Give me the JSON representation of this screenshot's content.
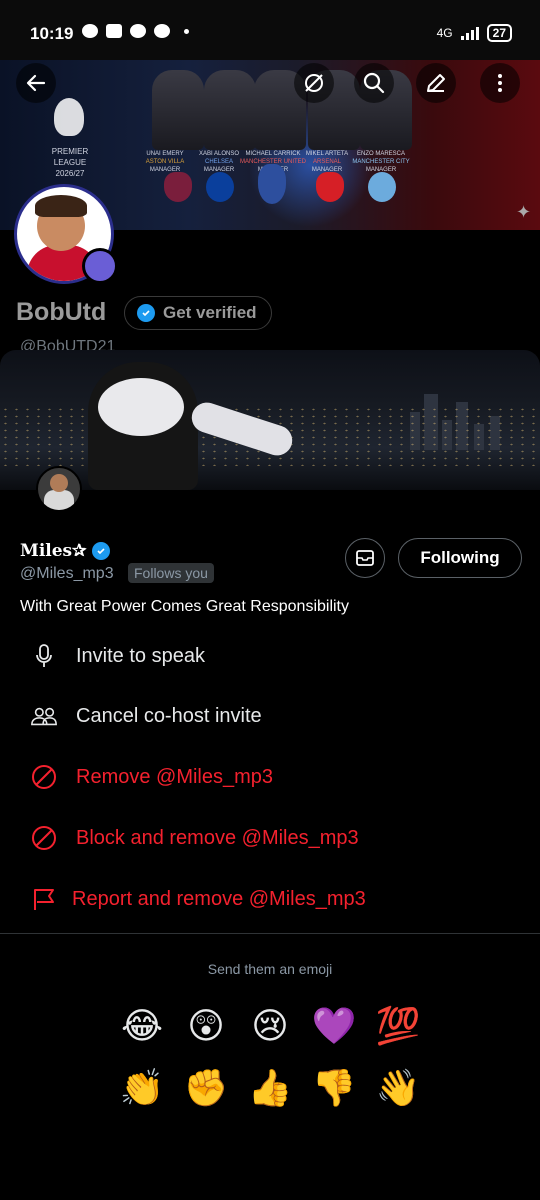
{
  "status_bar": {
    "time": "10:19",
    "network": "4G",
    "battery": "27"
  },
  "profile_header": {
    "banner": {
      "league": "PREMIER LEAGUE",
      "season": "2026/27",
      "managers": [
        {
          "name": "UNAI EMERY",
          "club": "ASTON VILLA",
          "role": "MANAGER"
        },
        {
          "name": "XABI ALONSO",
          "club": "CHELSEA",
          "role": "MANAGER"
        },
        {
          "name": "MICHAEL CARRICK",
          "club": "MANCHESTER UNITED",
          "role": "MANAGER"
        },
        {
          "name": "MIKEL ARTETA",
          "club": "ARSENAL",
          "role": "MANAGER"
        },
        {
          "name": "ENZO MARESCA",
          "club": "MANCHESTER CITY",
          "role": "MANAGER"
        }
      ]
    },
    "name": "BobUtd",
    "verify_label": "Get verified",
    "handle": "@BobUTD21"
  },
  "user_card": {
    "display_name": "Miles✰",
    "handle": "@Miles_mp3",
    "follows_you": "Follows you",
    "following_label": "Following",
    "bio": "With Great Power Comes Great Responsibility"
  },
  "actions": [
    {
      "label": "Invite to speak",
      "icon": "microphone-icon",
      "color": "#e7e9ea"
    },
    {
      "label": "Cancel co-host invite",
      "icon": "people-icon",
      "color": "#e7e9ea"
    },
    {
      "label": "Remove @Miles_mp3",
      "icon": "block-icon",
      "color": "#f4212e"
    },
    {
      "label": "Block and remove @Miles_mp3",
      "icon": "block-icon",
      "color": "#f4212e"
    },
    {
      "label": "Report and remove @Miles_mp3",
      "icon": "flag-icon",
      "color": "#f4212e"
    }
  ],
  "emoji_section": {
    "title": "Send them an emoji",
    "row1": [
      "😂",
      "😲",
      "😢",
      "💜",
      "💯"
    ],
    "row2": [
      "👏",
      "✊",
      "👍",
      "👎",
      "👋"
    ]
  }
}
